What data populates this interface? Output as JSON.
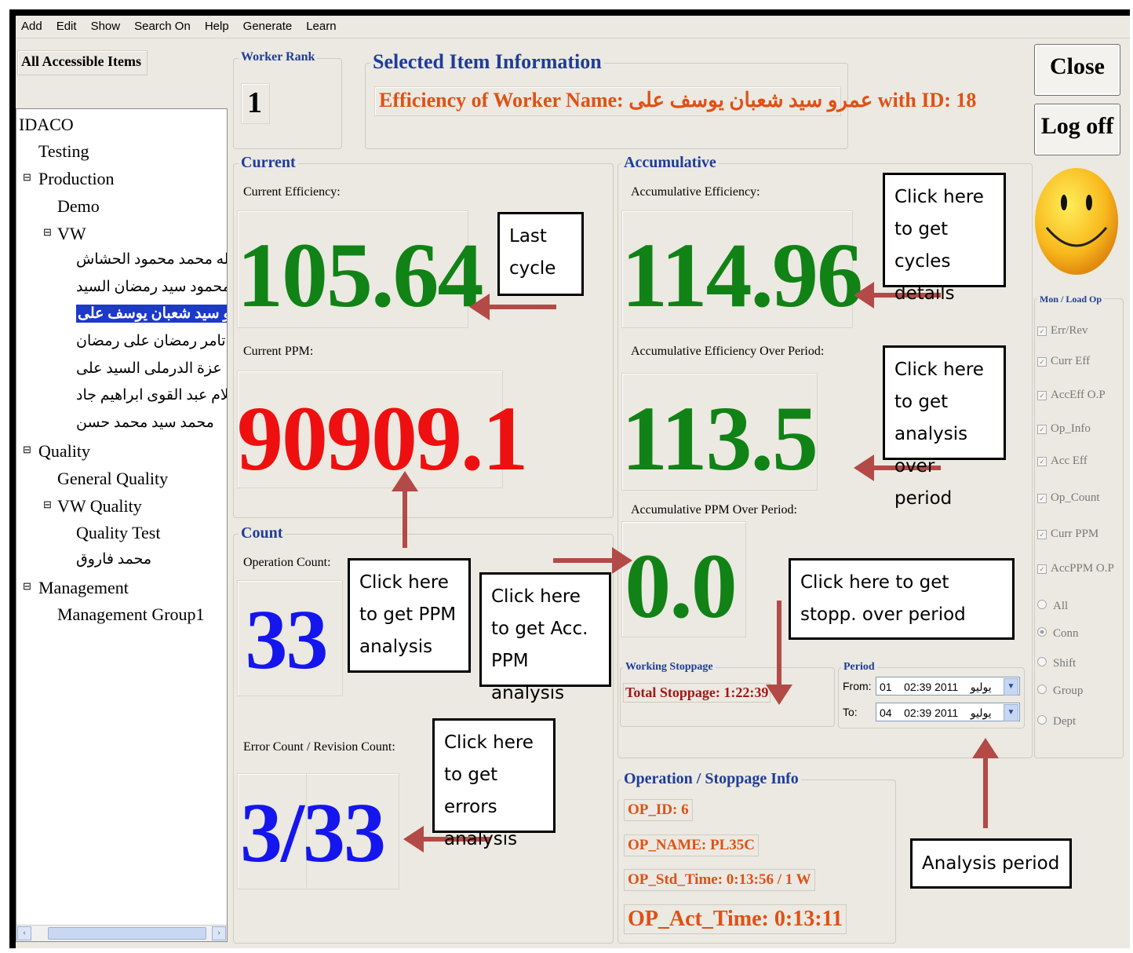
{
  "menu": [
    "Add",
    "Edit",
    "Show",
    "Search On",
    "Help",
    "Generate",
    "Learn"
  ],
  "tree": {
    "header": "All Accessible Items",
    "items": [
      {
        "label": "IDACO"
      },
      {
        "label": "Testing"
      },
      {
        "label": "Production",
        "expander": "⊟"
      },
      {
        "label": "Demo"
      },
      {
        "label": "VW",
        "expander": "⊟"
      },
      {
        "label": "عبد الله محمد محمود الحشاش"
      },
      {
        "label": "محمود سيد رمضان السيد"
      },
      {
        "label": "عمرو سيد شعبان يوسف على",
        "selected": true
      },
      {
        "label": "تامر رمضان على رمضان"
      },
      {
        "label": "عزة الدرملى السيد على"
      },
      {
        "label": "علام عبد القوى ابراهيم جاد"
      },
      {
        "label": "محمد سيد محمد حسن"
      },
      {
        "label": "Quality",
        "expander": "⊟"
      },
      {
        "label": "General Quality"
      },
      {
        "label": "VW Quality",
        "expander": "⊟"
      },
      {
        "label": "Quality Test"
      },
      {
        "label": "محمد فاروق"
      },
      {
        "label": "Management",
        "expander": "⊟"
      },
      {
        "label": "Management Group1"
      }
    ]
  },
  "worker_rank": {
    "label": "Worker Rank",
    "value": "1"
  },
  "selected_info": {
    "label": "Selected Item Information",
    "text": "Efficiency of Worker Name: عمرو سيد شعبان يوسف على with ID: 18"
  },
  "current": {
    "label": "Current",
    "eff_label": "Current Efficiency:",
    "eff_value": "105.64",
    "ppm_label": "Current PPM:",
    "ppm_value": "90909.1"
  },
  "count": {
    "label": "Count",
    "op_label": "Operation Count:",
    "op_value": "33",
    "err_label": "Error Count / Revision Count:",
    "err_value": "3/33"
  },
  "accumulative": {
    "label": "Accumulative",
    "eff_label": "Accumulative Efficiency:",
    "eff_value": "114.96",
    "eff_period_label": "Accumulative Efficiency Over Period:",
    "eff_period_value": "113.5",
    "ppm_period_label": "Accumulative PPM Over Period:",
    "ppm_period_value": "0.0"
  },
  "stoppage": {
    "label": "Working Stoppage",
    "text": "Total Stoppage: 1:22:39"
  },
  "period": {
    "label": "Period",
    "from_label": "From:",
    "from_value": "01    يوليو    2011 02:39",
    "to_label": "To:",
    "to_value": "04    يوليو    2011 02:39"
  },
  "op_info": {
    "label": "Operation / Stoppage Info",
    "op_id": "OP_ID: 6",
    "op_name": "OP_NAME: PL35C",
    "op_std": "OP_Std_Time: 0:13:56 / 1 W",
    "op_act": "OP_Act_Time: 0:13:11"
  },
  "buttons": {
    "close": "Close",
    "logoff": "Log off"
  },
  "mon": {
    "label": "Mon / Load Op",
    "checks": [
      "Err/Rev",
      "Curr Eff",
      "AccEff O.P",
      "Op_Info",
      "Acc Eff",
      "Op_Count",
      "Curr PPM",
      "AccPPM O.P"
    ],
    "radios": [
      "All",
      "Conn",
      "Shift",
      "Group",
      "Dept"
    ],
    "selected_radio": "Conn"
  },
  "callouts": {
    "last_cycle": "Last cycle",
    "cycles": "Click here to get cycles details",
    "analysis_period": "Click here to get analysis over period",
    "ppm": "Click here to get PPM analysis",
    "acc_ppm": "Click here to get Acc. PPM analysis",
    "stopp": "Click here to get stopp. over period",
    "errors": "Click here to get errors analysis",
    "period": "Analysis period"
  },
  "colors": {
    "green": "#118216",
    "red": "#ee1010",
    "blue": "#1515ee",
    "title_blue": "#1f3c9a",
    "orange": "#e05015",
    "arrow": "#b34a47",
    "selection": "#1c39c8"
  }
}
